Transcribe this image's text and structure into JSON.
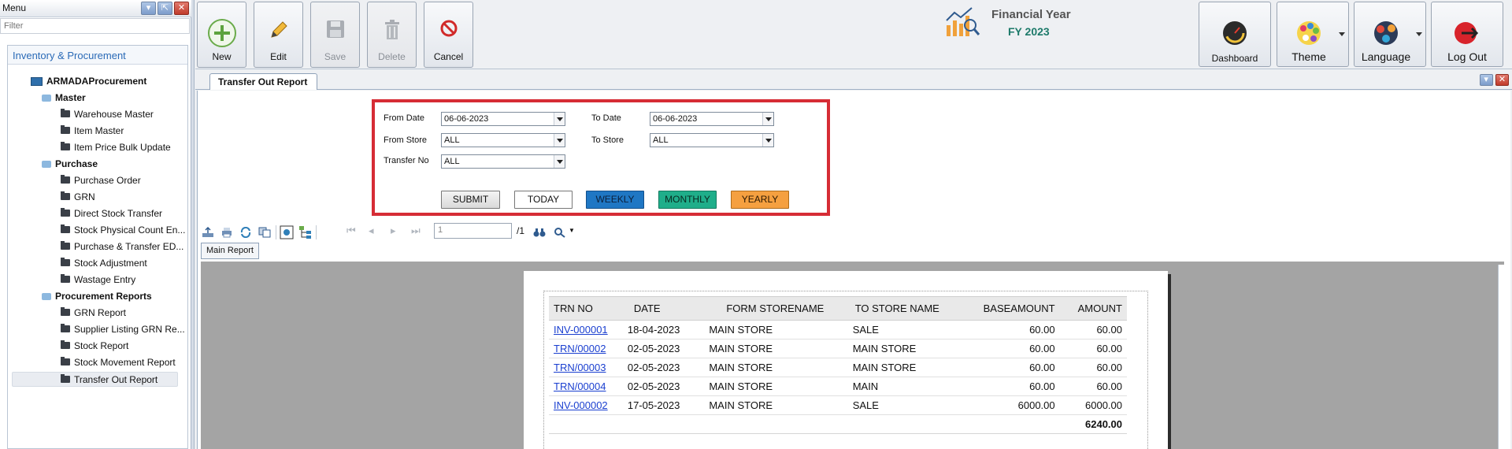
{
  "sidebar": {
    "title": "Menu",
    "filter_placeholder": "Filter",
    "panel_title": "Inventory & Procurement",
    "root": "ARMADAProcurement",
    "groups": [
      {
        "label": "Master",
        "items": [
          "Warehouse Master",
          "Item Master",
          "Item Price Bulk Update"
        ]
      },
      {
        "label": "Purchase",
        "items": [
          "Purchase Order",
          "GRN",
          "Direct Stock Transfer",
          "Stock Physical Count En...",
          "Purchase & Transfer ED...",
          "Stock Adjustment",
          "Wastage Entry"
        ]
      },
      {
        "label": "Procurement Reports",
        "items": [
          "GRN Report",
          "Supplier Listing GRN Re...",
          "Stock Report",
          "Stock Movement Report",
          "Transfer Out Report"
        ]
      }
    ],
    "selected_item": "Transfer Out Report"
  },
  "toolbar": {
    "new": "New",
    "edit": "Edit",
    "save": "Save",
    "delete": "Delete",
    "cancel": "Cancel",
    "dashboard": "Dashboard",
    "theme": "Theme",
    "language": "Language",
    "logout": "Log Out"
  },
  "financial_year": {
    "title": "Financial Year",
    "value": "FY 2023"
  },
  "tab": {
    "title": "Transfer Out Report"
  },
  "filters": {
    "from_date_label": "From Date",
    "from_date": "06-06-2023",
    "to_date_label": "To Date",
    "to_date": "06-06-2023",
    "from_store_label": "From Store",
    "from_store": "ALL",
    "to_store_label": "To Store",
    "to_store": "ALL",
    "transfer_no_label": "Transfer No",
    "transfer_no": "ALL",
    "buttons": {
      "submit": "SUBMIT",
      "today": "TODAY",
      "weekly": "WEEKLY",
      "monthly": "MONTHLY",
      "yearly": "YEARLY"
    }
  },
  "viewer": {
    "page": "1",
    "page_total": "/1",
    "main_tab": "Main Report"
  },
  "report": {
    "headers": [
      "TRN NO",
      "DATE",
      "FORM STORENAME",
      "TO STORE NAME",
      "BASEAMOUNT",
      "AMOUNT"
    ],
    "rows": [
      [
        "INV-000001",
        "18-04-2023",
        "MAIN STORE",
        "SALE",
        "60.00",
        "60.00"
      ],
      [
        "TRN/00002",
        "02-05-2023",
        "MAIN STORE",
        "MAIN STORE",
        "60.00",
        "60.00"
      ],
      [
        "TRN/00003",
        "02-05-2023",
        "MAIN STORE",
        "MAIN STORE",
        "60.00",
        "60.00"
      ],
      [
        "TRN/00004",
        "02-05-2023",
        "MAIN STORE",
        "MAIN",
        "60.00",
        "60.00"
      ],
      [
        "INV-000002",
        "17-05-2023",
        "MAIN STORE",
        "SALE",
        "6000.00",
        "6000.00"
      ]
    ],
    "total": "6240.00"
  },
  "colors": {
    "highlight_border": "#d62c35",
    "weekly": "#1f77c4",
    "monthly": "#1fae8a",
    "yearly": "#f5a040",
    "link": "#1a3fd0"
  }
}
